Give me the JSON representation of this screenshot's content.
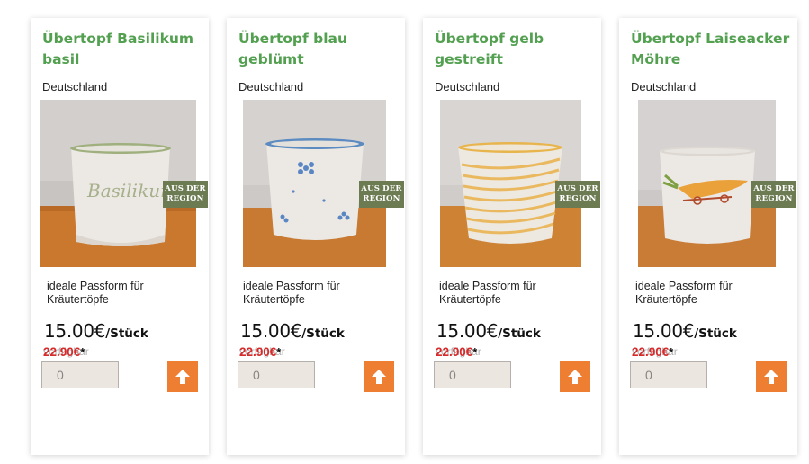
{
  "colors": {
    "title_green": "#52a050",
    "badge_olive": "#6d7b52",
    "button_orange": "#ee7f32",
    "old_price_red": "#d72a2a"
  },
  "products": [
    {
      "title": "Übertopf Basilikum basil",
      "origin": "Deutschland",
      "badge": "AUS DER REGION",
      "description": "ideale Passform für Kräutertöpfe",
      "price": "15.00€",
      "unit": "/Stück",
      "old_price": "22.90€",
      "old_price_ghost": "verfügbar",
      "asterisk": "*",
      "quantity": "0",
      "button_icon": "arrow-up-icon",
      "pot_text": "Basilikum"
    },
    {
      "title": "Übertopf blau geblümt",
      "origin": "Deutschland",
      "badge": "AUS DER REGION",
      "description": "ideale Passform für Kräutertöpfe",
      "price": "15.00€",
      "unit": "/Stück",
      "old_price": "22.90€",
      "old_price_ghost": "verfügbar",
      "asterisk": "*",
      "quantity": "0",
      "button_icon": "arrow-up-icon"
    },
    {
      "title": "Übertopf gelb gestreift",
      "origin": "Deutschland",
      "badge": "AUS DER REGION",
      "description": "ideale Passform für Kräutertöpfe",
      "price": "15.00€",
      "unit": "/Stück",
      "old_price": "22.90€",
      "old_price_ghost": "verfügbar",
      "asterisk": "*",
      "quantity": "0",
      "button_icon": "arrow-up-icon"
    },
    {
      "title": "Übertopf Laiseacker Möhre",
      "origin": "Deutschland",
      "badge": "AUS DER REGION",
      "description": "ideale Passform für Kräutertöpfe",
      "price": "15.00€",
      "unit": "/Stück",
      "old_price": "22.90€",
      "old_price_ghost": "verfügbar",
      "asterisk": "*",
      "quantity": "0",
      "button_icon": "arrow-up-icon"
    }
  ]
}
